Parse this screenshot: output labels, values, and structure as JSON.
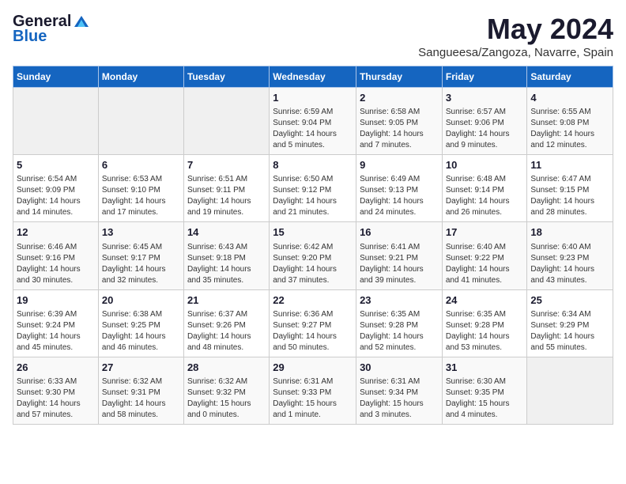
{
  "header": {
    "logo_general": "General",
    "logo_blue": "Blue",
    "month_year": "May 2024",
    "location": "Sangueesa/Zangoza, Navarre, Spain"
  },
  "weekdays": [
    "Sunday",
    "Monday",
    "Tuesday",
    "Wednesday",
    "Thursday",
    "Friday",
    "Saturday"
  ],
  "weeks": [
    [
      {
        "day": "",
        "info": ""
      },
      {
        "day": "",
        "info": ""
      },
      {
        "day": "",
        "info": ""
      },
      {
        "day": "1",
        "info": "Sunrise: 6:59 AM\nSunset: 9:04 PM\nDaylight: 14 hours\nand 5 minutes."
      },
      {
        "day": "2",
        "info": "Sunrise: 6:58 AM\nSunset: 9:05 PM\nDaylight: 14 hours\nand 7 minutes."
      },
      {
        "day": "3",
        "info": "Sunrise: 6:57 AM\nSunset: 9:06 PM\nDaylight: 14 hours\nand 9 minutes."
      },
      {
        "day": "4",
        "info": "Sunrise: 6:55 AM\nSunset: 9:08 PM\nDaylight: 14 hours\nand 12 minutes."
      }
    ],
    [
      {
        "day": "5",
        "info": "Sunrise: 6:54 AM\nSunset: 9:09 PM\nDaylight: 14 hours\nand 14 minutes."
      },
      {
        "day": "6",
        "info": "Sunrise: 6:53 AM\nSunset: 9:10 PM\nDaylight: 14 hours\nand 17 minutes."
      },
      {
        "day": "7",
        "info": "Sunrise: 6:51 AM\nSunset: 9:11 PM\nDaylight: 14 hours\nand 19 minutes."
      },
      {
        "day": "8",
        "info": "Sunrise: 6:50 AM\nSunset: 9:12 PM\nDaylight: 14 hours\nand 21 minutes."
      },
      {
        "day": "9",
        "info": "Sunrise: 6:49 AM\nSunset: 9:13 PM\nDaylight: 14 hours\nand 24 minutes."
      },
      {
        "day": "10",
        "info": "Sunrise: 6:48 AM\nSunset: 9:14 PM\nDaylight: 14 hours\nand 26 minutes."
      },
      {
        "day": "11",
        "info": "Sunrise: 6:47 AM\nSunset: 9:15 PM\nDaylight: 14 hours\nand 28 minutes."
      }
    ],
    [
      {
        "day": "12",
        "info": "Sunrise: 6:46 AM\nSunset: 9:16 PM\nDaylight: 14 hours\nand 30 minutes."
      },
      {
        "day": "13",
        "info": "Sunrise: 6:45 AM\nSunset: 9:17 PM\nDaylight: 14 hours\nand 32 minutes."
      },
      {
        "day": "14",
        "info": "Sunrise: 6:43 AM\nSunset: 9:18 PM\nDaylight: 14 hours\nand 35 minutes."
      },
      {
        "day": "15",
        "info": "Sunrise: 6:42 AM\nSunset: 9:20 PM\nDaylight: 14 hours\nand 37 minutes."
      },
      {
        "day": "16",
        "info": "Sunrise: 6:41 AM\nSunset: 9:21 PM\nDaylight: 14 hours\nand 39 minutes."
      },
      {
        "day": "17",
        "info": "Sunrise: 6:40 AM\nSunset: 9:22 PM\nDaylight: 14 hours\nand 41 minutes."
      },
      {
        "day": "18",
        "info": "Sunrise: 6:40 AM\nSunset: 9:23 PM\nDaylight: 14 hours\nand 43 minutes."
      }
    ],
    [
      {
        "day": "19",
        "info": "Sunrise: 6:39 AM\nSunset: 9:24 PM\nDaylight: 14 hours\nand 45 minutes."
      },
      {
        "day": "20",
        "info": "Sunrise: 6:38 AM\nSunset: 9:25 PM\nDaylight: 14 hours\nand 46 minutes."
      },
      {
        "day": "21",
        "info": "Sunrise: 6:37 AM\nSunset: 9:26 PM\nDaylight: 14 hours\nand 48 minutes."
      },
      {
        "day": "22",
        "info": "Sunrise: 6:36 AM\nSunset: 9:27 PM\nDaylight: 14 hours\nand 50 minutes."
      },
      {
        "day": "23",
        "info": "Sunrise: 6:35 AM\nSunset: 9:28 PM\nDaylight: 14 hours\nand 52 minutes."
      },
      {
        "day": "24",
        "info": "Sunrise: 6:35 AM\nSunset: 9:28 PM\nDaylight: 14 hours\nand 53 minutes."
      },
      {
        "day": "25",
        "info": "Sunrise: 6:34 AM\nSunset: 9:29 PM\nDaylight: 14 hours\nand 55 minutes."
      }
    ],
    [
      {
        "day": "26",
        "info": "Sunrise: 6:33 AM\nSunset: 9:30 PM\nDaylight: 14 hours\nand 57 minutes."
      },
      {
        "day": "27",
        "info": "Sunrise: 6:32 AM\nSunset: 9:31 PM\nDaylight: 14 hours\nand 58 minutes."
      },
      {
        "day": "28",
        "info": "Sunrise: 6:32 AM\nSunset: 9:32 PM\nDaylight: 15 hours\nand 0 minutes."
      },
      {
        "day": "29",
        "info": "Sunrise: 6:31 AM\nSunset: 9:33 PM\nDaylight: 15 hours\nand 1 minute."
      },
      {
        "day": "30",
        "info": "Sunrise: 6:31 AM\nSunset: 9:34 PM\nDaylight: 15 hours\nand 3 minutes."
      },
      {
        "day": "31",
        "info": "Sunrise: 6:30 AM\nSunset: 9:35 PM\nDaylight: 15 hours\nand 4 minutes."
      },
      {
        "day": "",
        "info": ""
      }
    ]
  ]
}
